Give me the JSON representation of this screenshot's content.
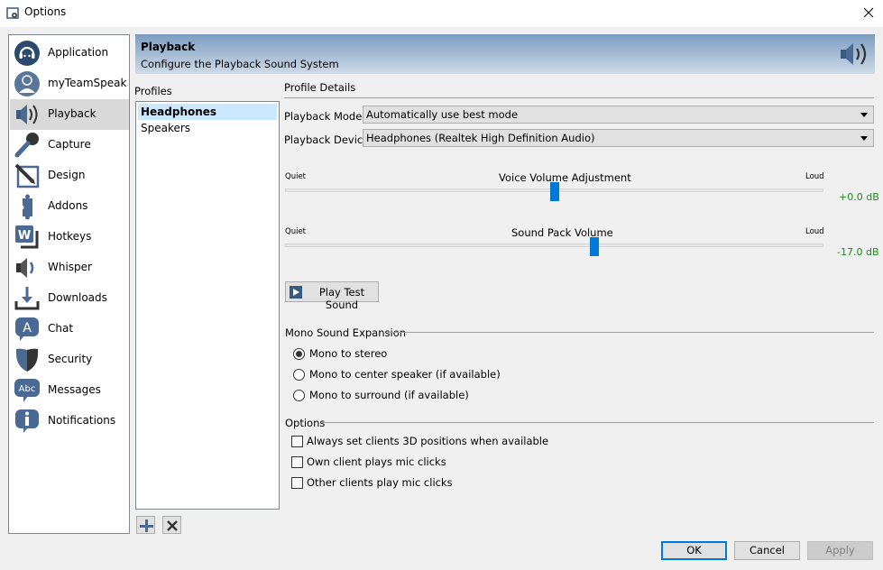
{
  "window": {
    "title": "Options",
    "close_icon": "close-icon"
  },
  "sidebar": {
    "selected": "Playback",
    "items": [
      {
        "label": "Application",
        "icon": "headset-icon"
      },
      {
        "label": "myTeamSpeak",
        "icon": "user-icon"
      },
      {
        "label": "Playback",
        "icon": "speaker-icon"
      },
      {
        "label": "Capture",
        "icon": "microphone-icon"
      },
      {
        "label": "Design",
        "icon": "pencil-icon"
      },
      {
        "label": "Addons",
        "icon": "puzzle-icon"
      },
      {
        "label": "Hotkeys",
        "icon": "keyboard-key-icon"
      },
      {
        "label": "Whisper",
        "icon": "whisper-icon"
      },
      {
        "label": "Downloads",
        "icon": "download-icon"
      },
      {
        "label": "Chat",
        "icon": "chat-icon"
      },
      {
        "label": "Security",
        "icon": "shield-icon"
      },
      {
        "label": "Messages",
        "icon": "messages-icon"
      },
      {
        "label": "Notifications",
        "icon": "info-icon"
      }
    ]
  },
  "banner": {
    "title": "Playback",
    "subtitle": "Configure the Playback Sound System",
    "icon": "speaker-icon"
  },
  "profiles": {
    "label": "Profiles",
    "items": [
      "Headphones",
      "Speakers"
    ],
    "selected": "Headphones",
    "add_icon": "plus-icon",
    "remove_icon": "x-icon"
  },
  "details": {
    "section_title": "Profile Details",
    "playback_mode": {
      "label": "Playback Mode:",
      "value": "Automatically use best mode"
    },
    "playback_device": {
      "label": "Playback Device:",
      "value": "Headphones (Realtek High Definition Audio)"
    },
    "voice_volume": {
      "title": "Voice Volume Adjustment",
      "min_label": "Quiet",
      "max_label": "Loud",
      "value_text": "+0.0 dB",
      "position_fraction": 0.5
    },
    "sound_pack_volume": {
      "title": "Sound Pack Volume",
      "min_label": "Quiet",
      "max_label": "Loud",
      "value_text": "-17.0 dB",
      "position_fraction": 0.575
    },
    "play_test_sound": "Play Test Sound",
    "mono_expansion": {
      "title": "Mono Sound Expansion",
      "options": [
        {
          "label": "Mono to stereo",
          "checked": true
        },
        {
          "label": "Mono to center speaker (if available)",
          "checked": false
        },
        {
          "label": "Mono to surround (if available)",
          "checked": false
        }
      ]
    },
    "options": {
      "title": "Options",
      "items": [
        {
          "label": "Always set clients 3D positions when available",
          "checked": false
        },
        {
          "label": "Own client plays mic clicks",
          "checked": false
        },
        {
          "label": "Other clients play mic clicks",
          "checked": false
        }
      ]
    }
  },
  "footer": {
    "ok": "OK",
    "cancel": "Cancel",
    "apply": "Apply"
  }
}
